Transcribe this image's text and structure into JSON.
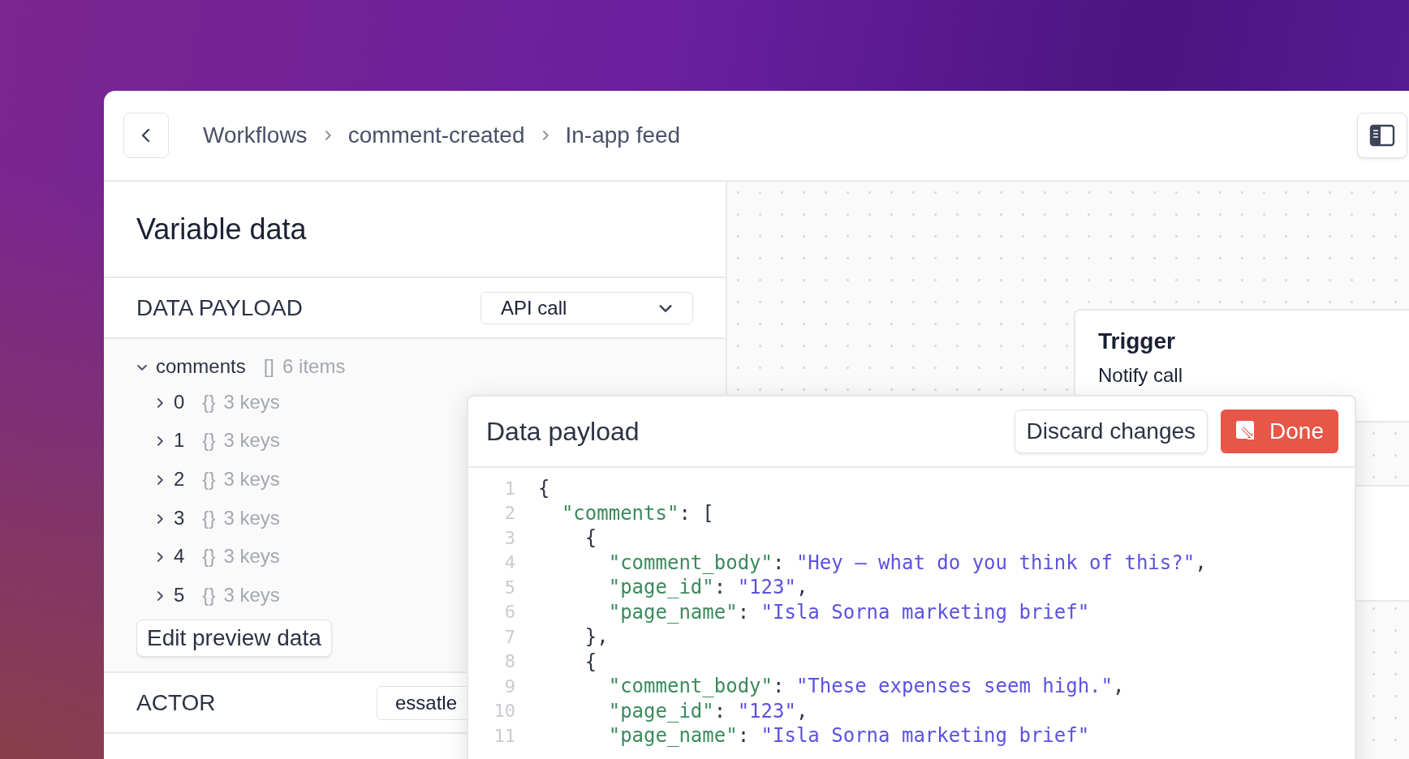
{
  "breadcrumb": [
    {
      "label": "Workflows"
    },
    {
      "label": "comment-created"
    },
    {
      "label": "In-app feed"
    }
  ],
  "panel": {
    "title": "Variable data"
  },
  "data_payload": {
    "label": "DATA PAYLOAD",
    "source": "API call",
    "tree": {
      "key": "comments",
      "expanded": true,
      "brackets": "[]",
      "summary": "6 items",
      "children": [
        {
          "key": "0",
          "expanded": false,
          "brackets": "{}",
          "summary": "3 keys"
        },
        {
          "key": "1",
          "expanded": false,
          "brackets": "{}",
          "summary": "3 keys"
        },
        {
          "key": "2",
          "expanded": false,
          "brackets": "{}",
          "summary": "3 keys"
        },
        {
          "key": "3",
          "expanded": false,
          "brackets": "{}",
          "summary": "3 keys"
        },
        {
          "key": "4",
          "expanded": false,
          "brackets": "{}",
          "summary": "3 keys"
        },
        {
          "key": "5",
          "expanded": false,
          "brackets": "{}",
          "summary": "3 keys"
        }
      ]
    },
    "edit_button": "Edit preview data"
  },
  "actor": {
    "label": "ACTOR",
    "value": "essatle"
  },
  "canvas": {
    "trigger": {
      "title": "Trigger",
      "subtitle": "Notify call"
    }
  },
  "modal": {
    "title": "Data payload",
    "discard_button": "Discard changes",
    "done_button": "Done",
    "lines": [
      {
        "number": "1",
        "tokens": [
          {
            "kind": "punct",
            "text": "{"
          }
        ]
      },
      {
        "number": "2",
        "tokens": [
          {
            "kind": "key",
            "text": "  \"comments\""
          },
          {
            "kind": "punct",
            "text": ": ["
          }
        ]
      },
      {
        "number": "3",
        "tokens": [
          {
            "kind": "punct",
            "text": "    {"
          }
        ]
      },
      {
        "number": "4",
        "tokens": [
          {
            "kind": "key",
            "text": "      \"comment_body\""
          },
          {
            "kind": "punct",
            "text": ": "
          },
          {
            "kind": "string",
            "text": "\"Hey — what do you think of this?\""
          },
          {
            "kind": "punct",
            "text": ","
          }
        ]
      },
      {
        "number": "5",
        "tokens": [
          {
            "kind": "key",
            "text": "      \"page_id\""
          },
          {
            "kind": "punct",
            "text": ": "
          },
          {
            "kind": "string",
            "text": "\"123\""
          },
          {
            "kind": "punct",
            "text": ","
          }
        ]
      },
      {
        "number": "6",
        "tokens": [
          {
            "kind": "key",
            "text": "      \"page_name\""
          },
          {
            "kind": "punct",
            "text": ": "
          },
          {
            "kind": "string",
            "text": "\"Isla Sorna marketing brief\""
          }
        ]
      },
      {
        "number": "7",
        "tokens": [
          {
            "kind": "punct",
            "text": "    },"
          }
        ]
      },
      {
        "number": "8",
        "tokens": [
          {
            "kind": "punct",
            "text": "    {"
          }
        ]
      },
      {
        "number": "9",
        "tokens": [
          {
            "kind": "key",
            "text": "      \"comment_body\""
          },
          {
            "kind": "punct",
            "text": ": "
          },
          {
            "kind": "string",
            "text": "\"These expenses seem high.\""
          },
          {
            "kind": "punct",
            "text": ","
          }
        ]
      },
      {
        "number": "10",
        "tokens": [
          {
            "kind": "key",
            "text": "      \"page_id\""
          },
          {
            "kind": "punct",
            "text": ": "
          },
          {
            "kind": "string",
            "text": "\"123\""
          },
          {
            "kind": "punct",
            "text": ","
          }
        ]
      },
      {
        "number": "11",
        "tokens": [
          {
            "kind": "key",
            "text": "      \"page_name\""
          },
          {
            "kind": "punct",
            "text": ": "
          },
          {
            "kind": "string",
            "text": "\"Isla Sorna marketing brief\""
          }
        ]
      }
    ]
  }
}
